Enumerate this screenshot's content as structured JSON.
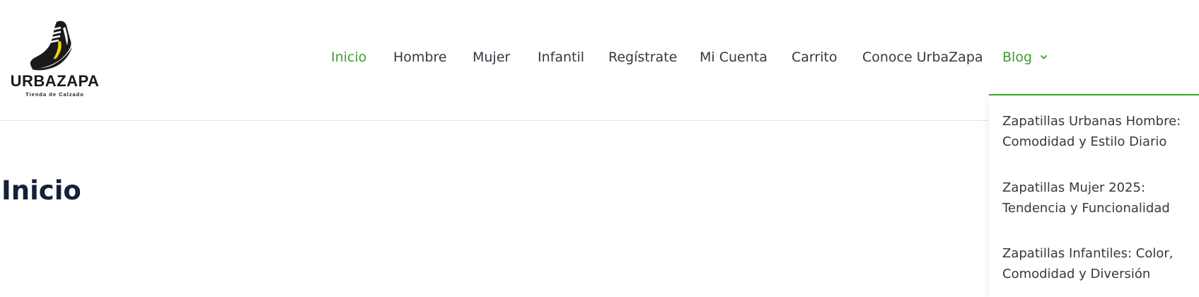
{
  "brand": {
    "name": "URBAZAPA",
    "tagline": "Tienda de Calzado",
    "logo_icon": "sneaker-icon",
    "accent_color": "#3e9f2f"
  },
  "nav": {
    "items": [
      {
        "label": "Inicio",
        "active": true
      },
      {
        "label": "Hombre"
      },
      {
        "label": "Mujer"
      },
      {
        "label": "Infantil"
      },
      {
        "label": "Regístrate"
      },
      {
        "label": "Mi Cuenta"
      },
      {
        "label": "Carrito"
      },
      {
        "label": "Conoce UrbaZapa"
      }
    ],
    "blog": {
      "label": "Blog",
      "icon": "chevron-down-icon",
      "expanded": true
    }
  },
  "dropdown": {
    "items": [
      {
        "line1": "Zapatillas Urbanas Hombre:",
        "line2": "Comodidad y Estilo Diario"
      },
      {
        "line1": "Zapatillas Mujer 2025:",
        "line2": "Tendencia y Funcionalidad"
      },
      {
        "line1": "Zapatillas Infantiles: Color,",
        "line2": "Comodidad y Diversión"
      }
    ]
  },
  "page": {
    "title": "Inicio"
  }
}
